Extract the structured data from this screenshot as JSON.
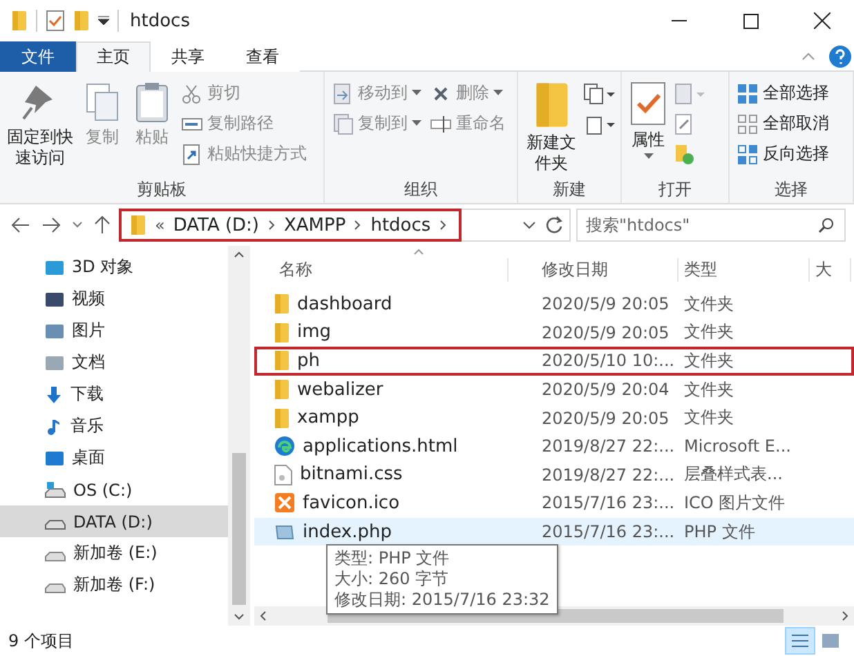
{
  "window": {
    "title": "htdocs"
  },
  "ribbon_tabs": [
    {
      "label": "文件",
      "kind": "file",
      "selected": false
    },
    {
      "label": "主页",
      "kind": "tab",
      "selected": true
    },
    {
      "label": "共享",
      "kind": "tab",
      "selected": false
    },
    {
      "label": "查看",
      "kind": "tab",
      "selected": false
    }
  ],
  "ribbon_groups": [
    {
      "label": "剪贴板",
      "items": [
        {
          "label": "固定到快速访问",
          "kind": "large",
          "disabled": false
        },
        {
          "label": "复制",
          "kind": "large",
          "disabled": true
        },
        {
          "label": "粘贴",
          "kind": "large",
          "disabled": true
        },
        {
          "label": "剪切",
          "kind": "small",
          "disabled": true
        },
        {
          "label": "复制路径",
          "kind": "small",
          "disabled": true
        },
        {
          "label": "粘贴快捷方式",
          "kind": "small",
          "disabled": true
        }
      ]
    },
    {
      "label": "组织",
      "items": [
        {
          "label": "移动到",
          "kind": "small",
          "disabled": true
        },
        {
          "label": "复制到",
          "kind": "small",
          "disabled": true
        },
        {
          "label": "删除",
          "kind": "small",
          "disabled": true
        },
        {
          "label": "重命名",
          "kind": "small",
          "disabled": true
        }
      ]
    },
    {
      "label": "新建",
      "items": [
        {
          "label": "新建文件夹",
          "kind": "large",
          "disabled": false
        }
      ]
    },
    {
      "label": "打开",
      "items": [
        {
          "label": "属性",
          "kind": "large",
          "disabled": false
        }
      ]
    },
    {
      "label": "选择",
      "items": [
        {
          "label": "全部选择",
          "kind": "small",
          "disabled": false
        },
        {
          "label": "全部取消",
          "kind": "small",
          "disabled": false
        },
        {
          "label": "反向选择",
          "kind": "small",
          "disabled": false
        }
      ]
    }
  ],
  "address": {
    "overflow": "«",
    "crumbs": [
      "DATA (D:)",
      "XAMPP",
      "htdocs"
    ],
    "highlighted": true
  },
  "search": {
    "placeholder": "搜索\"htdocs\""
  },
  "sidebar": {
    "items": [
      {
        "label": "3D 对象",
        "selected": false
      },
      {
        "label": "视频",
        "selected": false
      },
      {
        "label": "图片",
        "selected": false
      },
      {
        "label": "文档",
        "selected": false
      },
      {
        "label": "下载",
        "selected": false
      },
      {
        "label": "音乐",
        "selected": false
      },
      {
        "label": "桌面",
        "selected": false
      },
      {
        "label": "OS (C:)",
        "selected": false
      },
      {
        "label": "DATA (D:)",
        "selected": true
      },
      {
        "label": "新加卷 (E:)",
        "selected": false
      },
      {
        "label": "新加卷 (F:)",
        "selected": false
      }
    ]
  },
  "table": {
    "columns": [
      "名称",
      "修改日期",
      "类型",
      "大"
    ],
    "rows": [
      {
        "kind": "folder",
        "name": "dashboard",
        "date": "2020/5/9 20:05",
        "type": "文件夹",
        "highlighted": false,
        "hovered": false
      },
      {
        "kind": "folder",
        "name": "img",
        "date": "2020/5/9 20:05",
        "type": "文件夹",
        "highlighted": false,
        "hovered": false
      },
      {
        "kind": "folder",
        "name": "ph",
        "date": "2020/5/10 10:...",
        "type": "文件夹",
        "highlighted": true,
        "hovered": false
      },
      {
        "kind": "folder",
        "name": "webalizer",
        "date": "2020/5/9 20:04",
        "type": "文件夹",
        "highlighted": false,
        "hovered": false
      },
      {
        "kind": "folder",
        "name": "xampp",
        "date": "2020/5/9 20:05",
        "type": "文件夹",
        "highlighted": false,
        "hovered": false
      },
      {
        "kind": "html",
        "name": "applications.html",
        "date": "2019/8/27 22:...",
        "type": "Microsoft E...",
        "highlighted": false,
        "hovered": false
      },
      {
        "kind": "css",
        "name": "bitnami.css",
        "date": "2019/8/27 22:...",
        "type": "层叠样式表...",
        "highlighted": false,
        "hovered": false
      },
      {
        "kind": "ico",
        "name": "favicon.ico",
        "date": "2015/7/16 23:...",
        "type": "ICO 图片文件",
        "highlighted": false,
        "hovered": false
      },
      {
        "kind": "php",
        "name": "index.php",
        "date": "2015/7/16 23:...",
        "type": "PHP 文件",
        "highlighted": false,
        "hovered": true
      }
    ]
  },
  "tooltip": {
    "lines": [
      "类型: PHP 文件",
      "大小: 260 字节",
      "修改日期: 2015/7/16 23:32"
    ]
  },
  "status_bar": {
    "count": "9 个项目",
    "views": [
      {
        "kind": "details",
        "selected": true
      },
      {
        "kind": "large",
        "selected": false
      }
    ]
  }
}
